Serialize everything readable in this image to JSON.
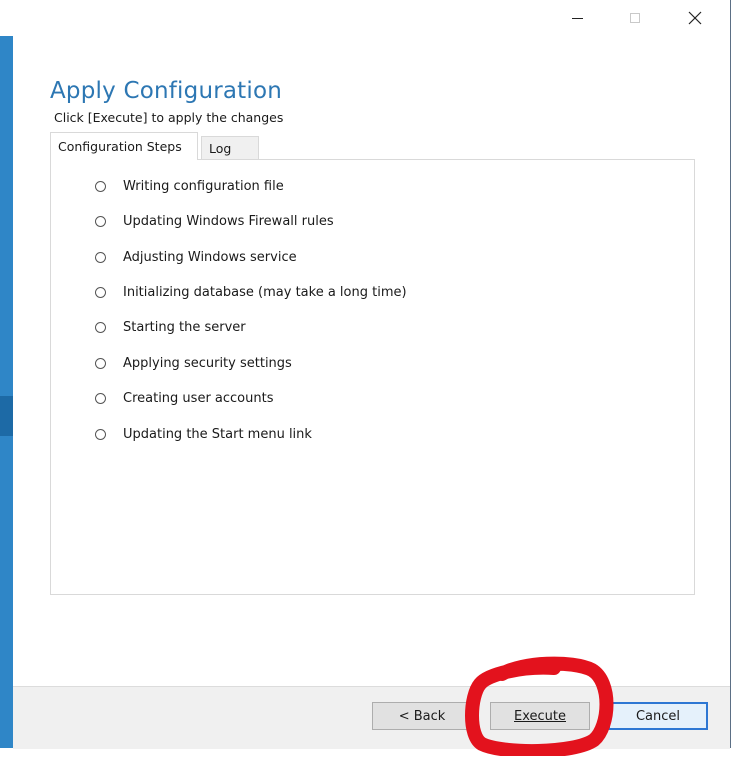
{
  "window": {
    "controls": {
      "minimize_glyph": "—",
      "maximize_glyph": "☐",
      "close_glyph": "✕"
    }
  },
  "header": {
    "title": "Apply Configuration",
    "subtitle": "Click [Execute] to apply the changes"
  },
  "tabs": [
    {
      "label": "Configuration Steps",
      "active": true
    },
    {
      "label": "Log",
      "active": false
    }
  ],
  "steps": [
    {
      "label": "Writing configuration file"
    },
    {
      "label": "Updating Windows Firewall rules"
    },
    {
      "label": "Adjusting Windows service"
    },
    {
      "label": "Initializing database (may take a long time)"
    },
    {
      "label": "Starting the server"
    },
    {
      "label": "Applying security settings"
    },
    {
      "label": "Creating user accounts"
    },
    {
      "label": "Updating the Start menu link"
    }
  ],
  "buttons": {
    "back": "< Back",
    "execute": "Execute",
    "cancel": "Cancel"
  },
  "colors": {
    "accent": "#2d77b3",
    "sidebar": "#2f86c7",
    "annotation": "#e3121d"
  }
}
